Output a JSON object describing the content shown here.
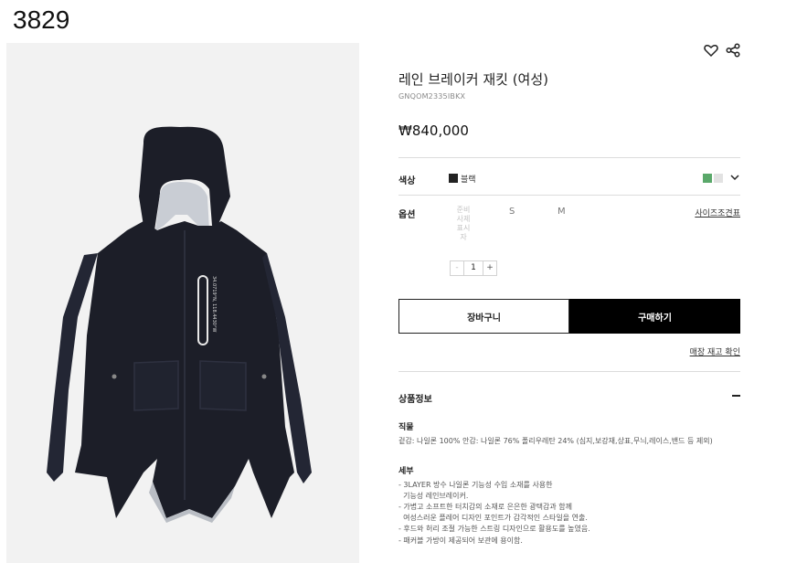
{
  "page_id": "3829",
  "product": {
    "title": "레인 브레이커 재킷 (여성)",
    "code": "GNQOM2335IBKX",
    "price": "₩840,000"
  },
  "color": {
    "label": "색상",
    "selected": "블랙",
    "selected_hex": "#222222",
    "swatches": [
      "#5aa86a",
      "#e2e2e2"
    ]
  },
  "option": {
    "label": "옵션",
    "unavailable": "준비 사제 표시 자",
    "sizes": [
      "S",
      "M"
    ],
    "size_guide": "사이즈조견표"
  },
  "quantity": {
    "minus": "-",
    "value": "1",
    "plus": "+"
  },
  "buttons": {
    "cart": "장바구니",
    "buy": "구매하기"
  },
  "store_check": "매장 재고 확인",
  "details": {
    "heading": "상품정보",
    "material_heading": "직물",
    "material_text": "겉감: 나일론 100% 안감: 나일론 76% 폴리우레탄 24% (심지,보강재,상표,무늬,레이스,밴드 등 제외)",
    "feature_heading": "세부",
    "features": [
      "- 3LAYER 방수 나일론 기능성 수입 소재를 사용한",
      "  기능성 레인브레이커.",
      "- 가볍고 소프트한 터치감의 소재로 은은한 광택감과 함께",
      "  여성스러운 플레어 디자인 포인트가 감각적인 스타일을 연출.",
      "- 후드와 허리 조절 가능한 스트링 디자인으로 활용도를 높였음.",
      "- 패커블 가방이 제공되어 보관에 용이함."
    ]
  },
  "jacket_print": "34.0719°N, 118.4430°W"
}
